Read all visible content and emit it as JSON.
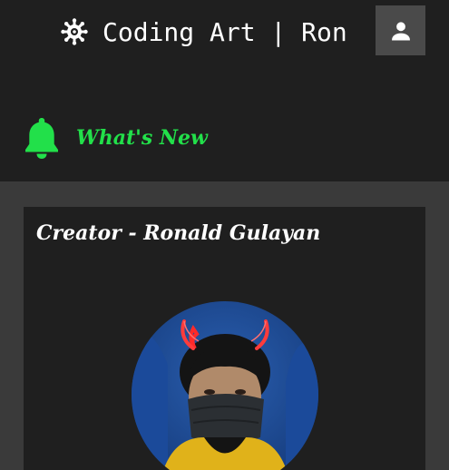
{
  "header": {
    "brand_text": "Coding Art | Ron",
    "brand_icon": "gear-icon",
    "user_icon": "user-icon"
  },
  "whats_new": {
    "label": "What's New",
    "icon": "bell-icon",
    "color": "#22e04a"
  },
  "card": {
    "title": "Creator - Ronald Gulayan"
  },
  "colors": {
    "page_bg": "#3a3a3a",
    "header_bg": "#1f1f1f",
    "card_bg": "#1f1f1f",
    "user_button_bg": "#4a4a4a",
    "accent_green": "#22e04a"
  }
}
